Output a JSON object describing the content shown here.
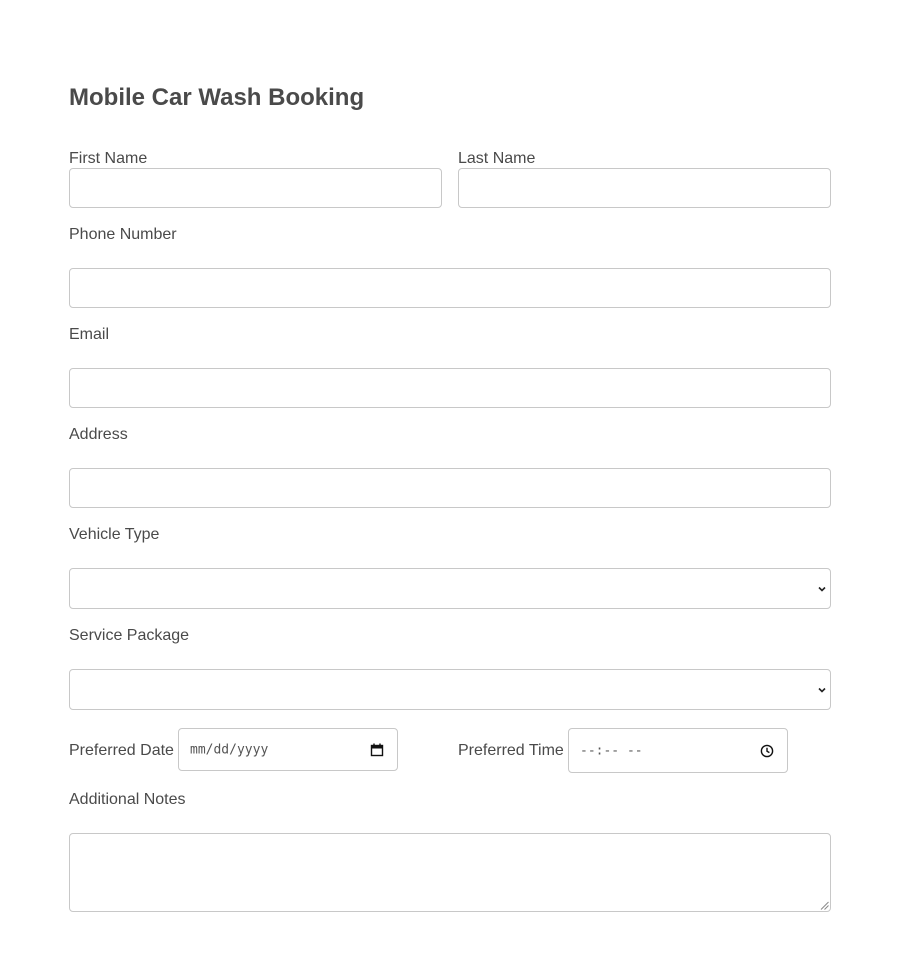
{
  "form": {
    "title": "Mobile Car Wash Booking",
    "first_name": {
      "label": "First Name",
      "value": ""
    },
    "last_name": {
      "label": "Last Name",
      "value": ""
    },
    "phone": {
      "label": "Phone Number",
      "value": ""
    },
    "email": {
      "label": "Email",
      "value": ""
    },
    "address": {
      "label": "Address",
      "value": ""
    },
    "vehicle_type": {
      "label": "Vehicle Type",
      "selected": ""
    },
    "service_package": {
      "label": "Service Package",
      "selected": ""
    },
    "preferred_date": {
      "label": "Preferred Date",
      "placeholder": "mm/dd/yyyy"
    },
    "preferred_time": {
      "label": "Preferred Time",
      "placeholder": "--:-- --"
    },
    "notes": {
      "label": "Additional Notes",
      "value": ""
    }
  },
  "icons": {
    "select_arrow": "chevron-down-icon",
    "date_picker": "calendar-icon",
    "time_picker": "clock-icon",
    "textarea_resize": "resize-grip-icon"
  },
  "colors": {
    "text": "#4a4a4a",
    "border": "#c8c8c8",
    "background": "#ffffff"
  }
}
